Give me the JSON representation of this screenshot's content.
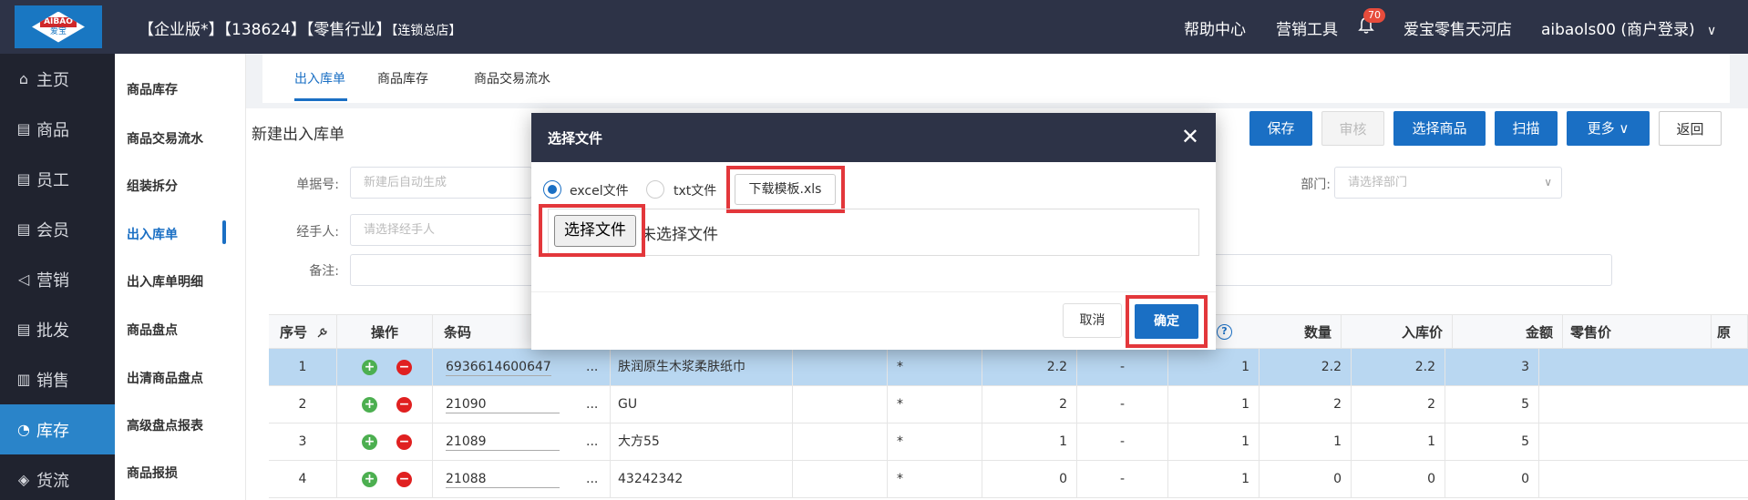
{
  "header": {
    "logo_text_top": "AIBAO",
    "logo_text_bottom": "爱宝",
    "company_main": "【企业版*】【138624】【零售行业】",
    "company_sub": "【连锁总店】",
    "help": "帮助中心",
    "marketing": "营销工具",
    "notification_count": "70",
    "store": "爱宝零售天河店",
    "user": "aibaols00 (商户登录)",
    "user_arrow": "∨"
  },
  "leftnav": {
    "items": [
      {
        "label": "主页",
        "icon": "home-icon",
        "glyph": "⌂"
      },
      {
        "label": "商品",
        "icon": "goods-icon",
        "glyph": "▤"
      },
      {
        "label": "员工",
        "icon": "staff-icon",
        "glyph": "▤"
      },
      {
        "label": "会员",
        "icon": "member-icon",
        "glyph": "▤"
      },
      {
        "label": "营销",
        "icon": "marketing-icon",
        "glyph": "◁"
      },
      {
        "label": "批发",
        "icon": "wholesale-icon",
        "glyph": "▤"
      },
      {
        "label": "销售",
        "icon": "sales-icon",
        "glyph": "▥"
      },
      {
        "label": "库存",
        "icon": "inventory-icon",
        "glyph": "◔"
      },
      {
        "label": "货流",
        "icon": "logistics-icon",
        "glyph": "◈"
      }
    ]
  },
  "submenu": {
    "items": [
      "商品库存",
      "商品交易流水",
      "组装拆分",
      "出入库单",
      "出入库单明细",
      "商品盘点",
      "出清商品盘点",
      "高级盘点报表",
      "商品报损"
    ]
  },
  "tabs": [
    "出入库单",
    "商品库存",
    "商品交易流水"
  ],
  "panel": {
    "title": "新建出入库单",
    "buttons": {
      "save": "保存",
      "audit": "审核",
      "select_goods": "选择商品",
      "scan": "扫描",
      "more": "更多 ∨",
      "back": "返回"
    }
  },
  "form": {
    "order_no_label": "单据号:",
    "order_no_placeholder": "新建后自动生成",
    "handler_label": "经手人:",
    "handler_placeholder": "请选择经手人",
    "remark_label": "备注:",
    "dept_label": "部门:",
    "dept_placeholder": "请选择部门",
    "dept_arrow": "∨"
  },
  "table": {
    "headers": [
      "序号",
      "操作",
      "条码",
      "?",
      "数量",
      "入库价",
      "金额",
      "零售价",
      "原"
    ],
    "rows": [
      {
        "no": "1",
        "barcode": "6936614600647",
        "name": "肤润原生木浆柔肤纸巾",
        "star": "*",
        "v1": "2.2",
        "dash": "-",
        "qty": "1",
        "price": "2.2",
        "amount": "2.2",
        "retail": "3"
      },
      {
        "no": "2",
        "barcode": "21090",
        "name": "GU",
        "star": "*",
        "v1": "2",
        "dash": "-",
        "qty": "1",
        "price": "2",
        "amount": "2",
        "retail": "5"
      },
      {
        "no": "3",
        "barcode": "21089",
        "name": "大方55",
        "star": "*",
        "v1": "1",
        "dash": "-",
        "qty": "1",
        "price": "1",
        "amount": "1",
        "retail": "5"
      },
      {
        "no": "4",
        "barcode": "21088",
        "name": "43242342",
        "star": "*",
        "v1": "0",
        "dash": "-",
        "qty": "1",
        "price": "0",
        "amount": "0",
        "retail": "0"
      }
    ],
    "ellipsis": "..."
  },
  "modal": {
    "title": "选择文件",
    "close": "✕",
    "radio_excel": "excel文件",
    "radio_txt": "txt文件",
    "download_template": "下载模板.xls",
    "choose_file": "选择文件",
    "file_status": "未选择文件",
    "cancel": "取消",
    "confirm": "确定"
  },
  "colors": {
    "accent": "#1a6fc4",
    "header_bg": "#2d3347",
    "highlight": "#e3373b"
  }
}
